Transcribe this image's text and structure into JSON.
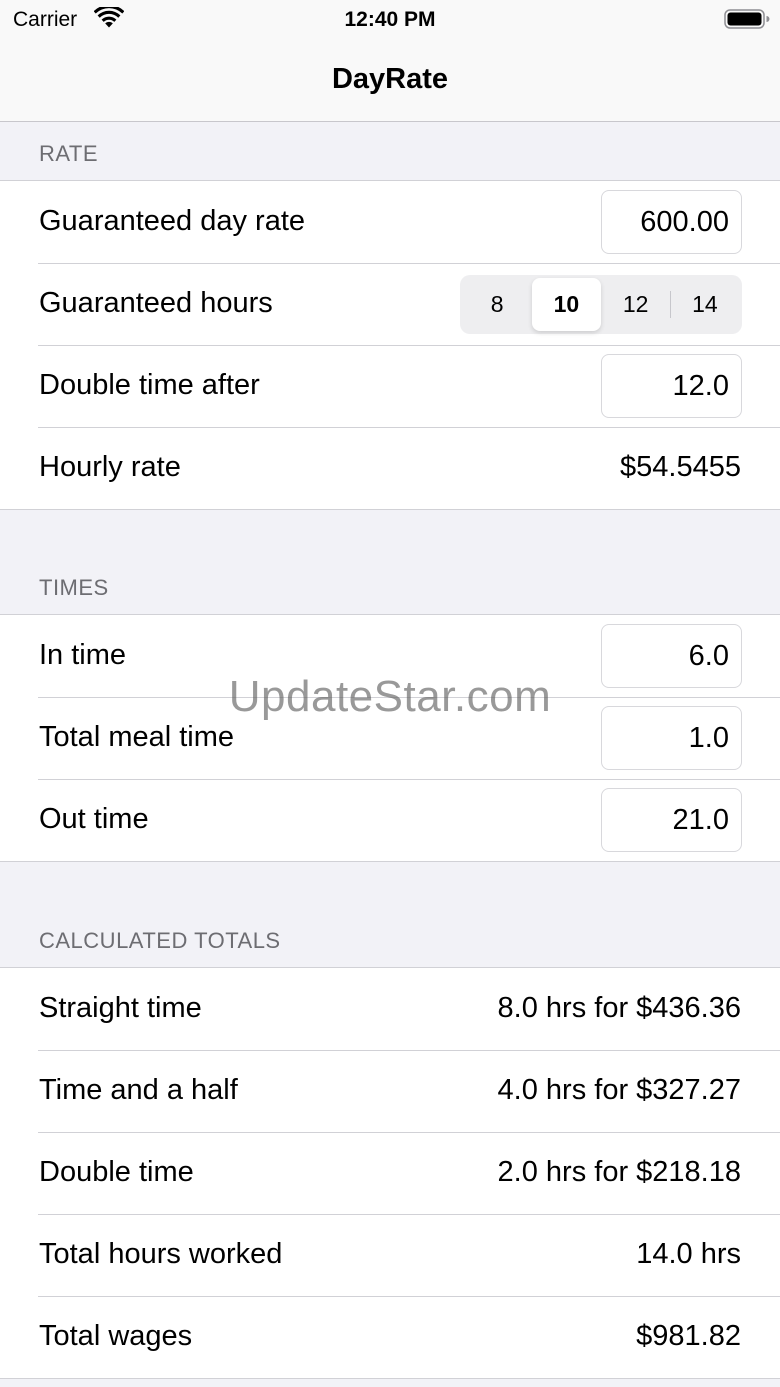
{
  "status": {
    "carrier": "Carrier",
    "time": "12:40 PM"
  },
  "nav": {
    "title": "DayRate"
  },
  "rate": {
    "header": "RATE",
    "day_rate_label": "Guaranteed day rate",
    "day_rate_value": "600.00",
    "hours_label": "Guaranteed hours",
    "hours_options": [
      "8",
      "10",
      "12",
      "14"
    ],
    "hours_selected": "10",
    "double_after_label": "Double time after",
    "double_after_value": "12.0",
    "hourly_label": "Hourly rate",
    "hourly_value": "$54.5455"
  },
  "times": {
    "header": "TIMES",
    "in_label": "In time",
    "in_value": "6.0",
    "meal_label": "Total meal time",
    "meal_value": "1.0",
    "out_label": "Out time",
    "out_value": "21.0"
  },
  "totals": {
    "header": "CALCULATED TOTALS",
    "rows": [
      {
        "label": "Straight time",
        "value": "8.0 hrs for $436.36"
      },
      {
        "label": "Time and a half",
        "value": "4.0 hrs for $327.27"
      },
      {
        "label": "Double time",
        "value": "2.0 hrs for $218.18"
      },
      {
        "label": "Total hours worked",
        "value": "14.0 hrs"
      },
      {
        "label": "Total wages",
        "value": "$981.82"
      }
    ]
  },
  "watermark": "UpdateStar.com",
  "colors": {
    "background": "#f2f2f7",
    "header_text": "#6d6d72",
    "separator": "#d1d1d6"
  },
  "icons": {
    "wifi": "wifi-icon",
    "battery": "battery-icon"
  }
}
